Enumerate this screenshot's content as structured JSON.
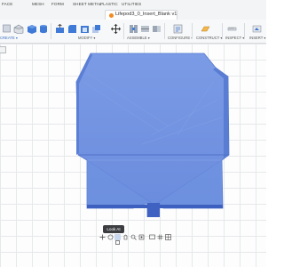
{
  "window": {
    "document_title": "Lifepod3_0_Insert_Blank v1"
  },
  "workspace_tabs": [
    "FACE",
    "MESH",
    "FORM",
    "SHEET METAL",
    "PLASTIC",
    "UTILITIES"
  ],
  "toolbar": {
    "groups": [
      "CREATE ▾",
      "MODIFY ▾",
      "ASSEMBLE ▾",
      "CONFIGURE ▾",
      "CONSTRUCT ▾",
      "INSPECT ▾",
      "INSERT ▾"
    ]
  },
  "viewport": {
    "model_color": "#6d8fe0",
    "tooltip": "Look At"
  },
  "colors": {
    "accent": "#3a6fc4",
    "model_fill": "#6b8ede",
    "model_shadow": "#4a6cc7"
  }
}
